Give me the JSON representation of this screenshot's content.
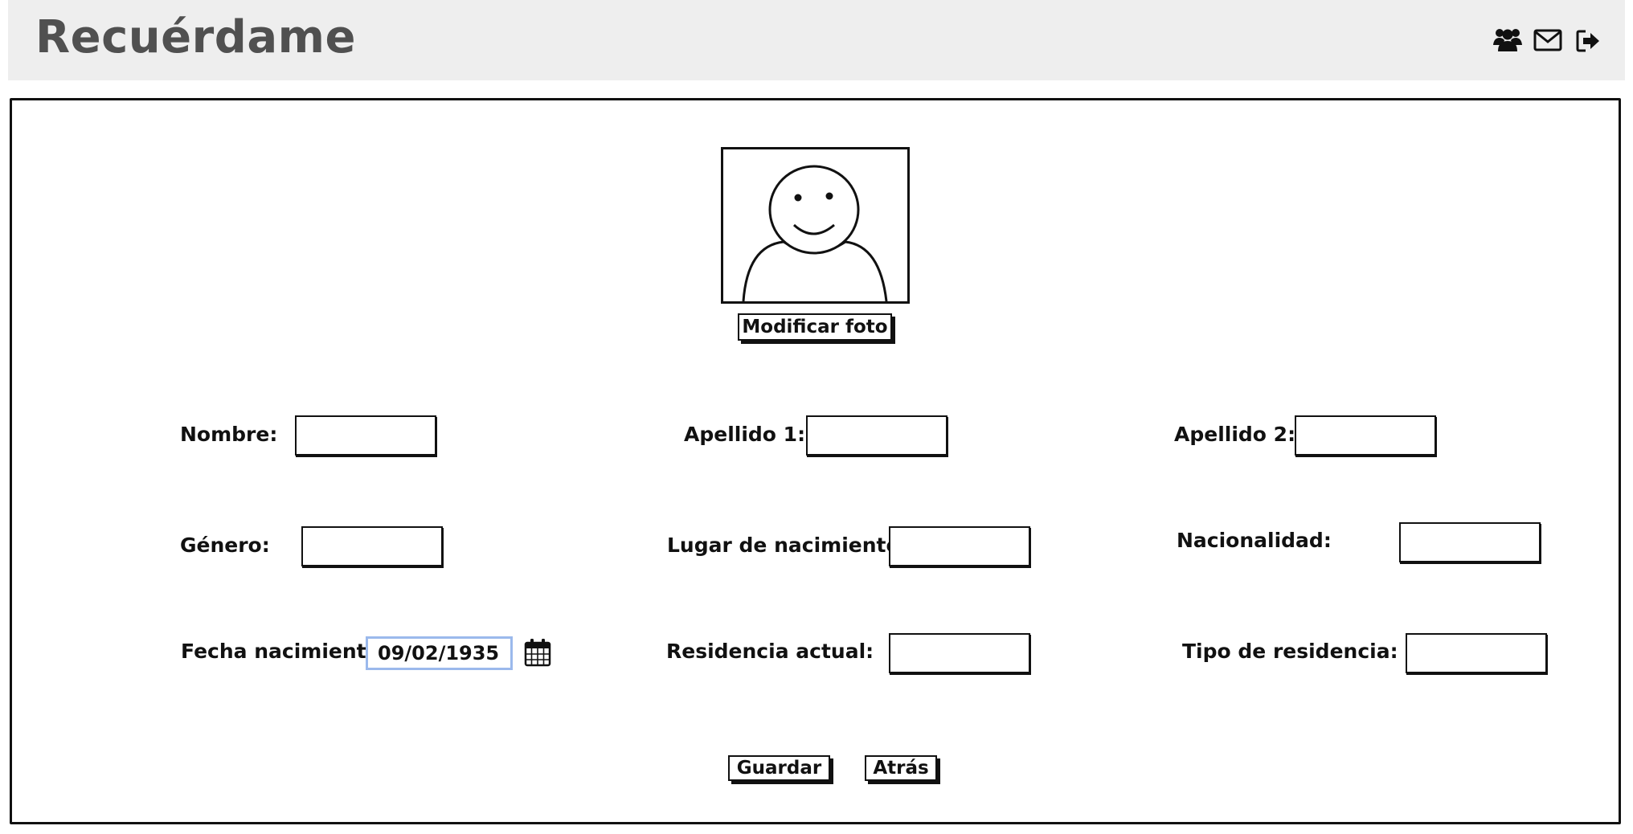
{
  "app": {
    "title": "Recuérdame"
  },
  "header_icons": [
    "users-icon",
    "envelope-icon",
    "sign-out-icon"
  ],
  "photo": {
    "button_label": "Modificar foto"
  },
  "form": {
    "nombre": {
      "label": "Nombre:",
      "value": ""
    },
    "apellido1": {
      "label": "Apellido 1:",
      "value": ""
    },
    "apellido2": {
      "label": "Apellido 2:",
      "value": ""
    },
    "genero": {
      "label": "Género:",
      "value": ""
    },
    "lugar_nacimiento": {
      "label": "Lugar de nacimiento:",
      "value": ""
    },
    "nacionalidad": {
      "label": "Nacionalidad:",
      "value": ""
    },
    "fecha_nacimiento": {
      "label": "Fecha nacimiento:",
      "value": "09/02/1935"
    },
    "residencia_actual": {
      "label": "Residencia actual:",
      "value": ""
    },
    "tipo_residencia": {
      "label": "Tipo de residencia:",
      "value": ""
    }
  },
  "actions": {
    "save_label": "Guardar",
    "back_label": "Atrás"
  },
  "colors": {
    "header_bg": "#eeeeee",
    "title": "#505050",
    "date_focus_border": "#9bb9ec"
  }
}
